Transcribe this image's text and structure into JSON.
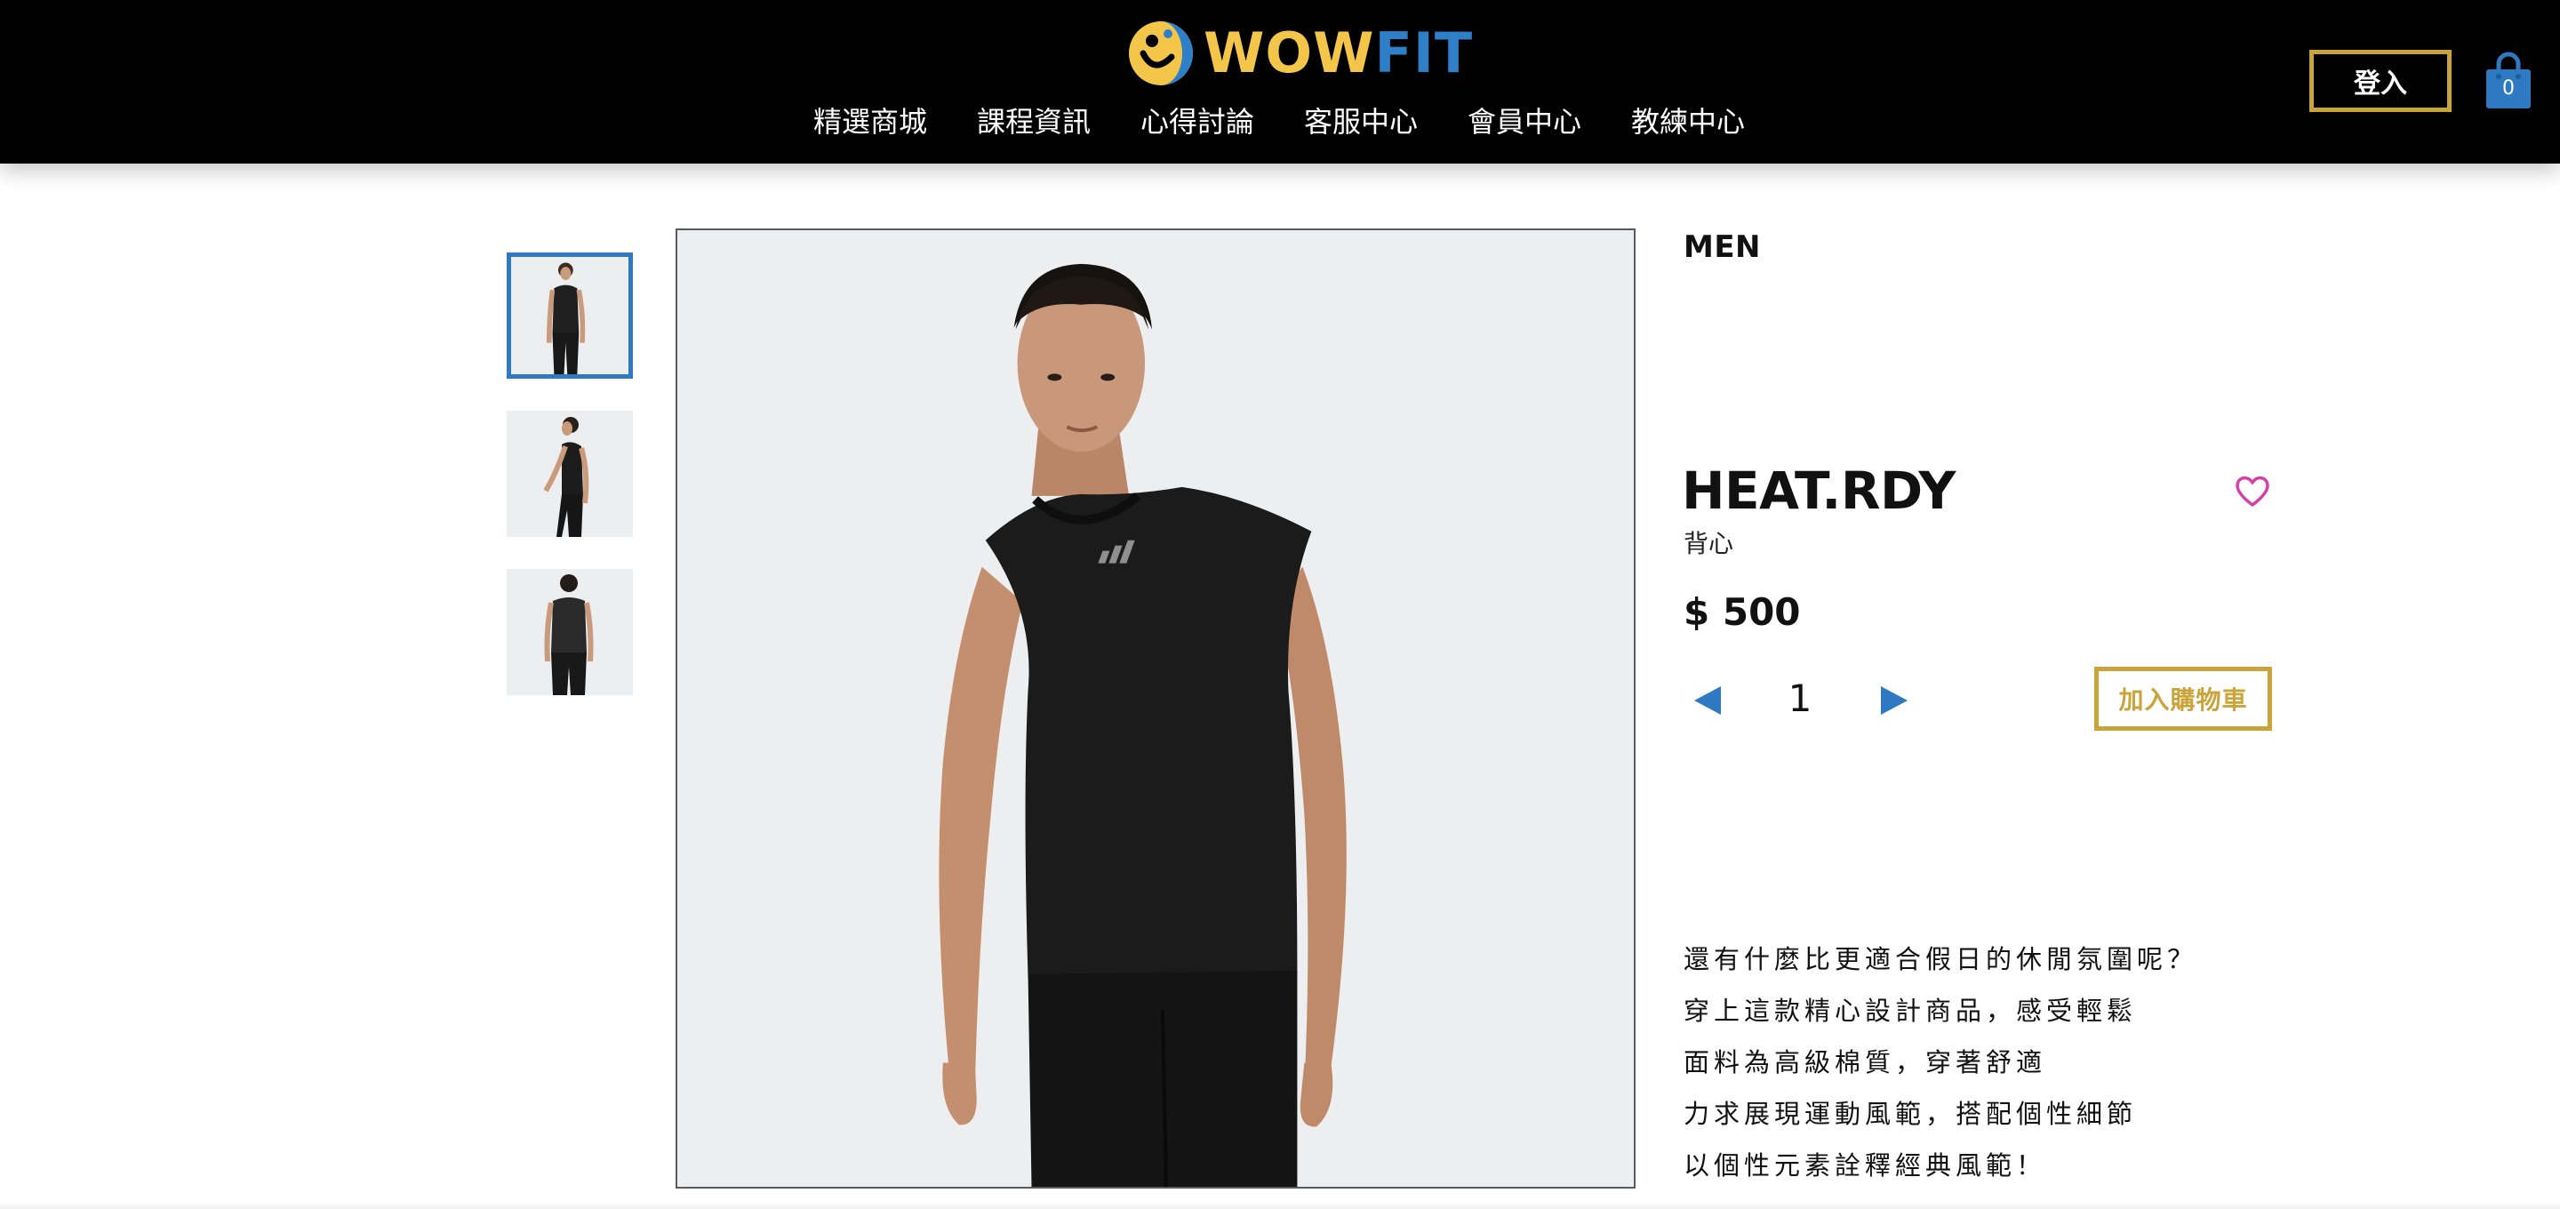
{
  "header": {
    "logo": {
      "word1": "WOW",
      "word2": "FIT",
      "icon": "wowfit-logo-icon"
    },
    "nav": [
      {
        "label": "精選商城"
      },
      {
        "label": "課程資訊"
      },
      {
        "label": "心得討論"
      },
      {
        "label": "客服中心"
      },
      {
        "label": "會員中心"
      },
      {
        "label": "教練中心"
      }
    ],
    "login_label": "登入",
    "cart_count": "0",
    "cart_icon": "shopping-bag-icon"
  },
  "gallery": {
    "selected_index": 0,
    "thumbnails": [
      {
        "view": "front"
      },
      {
        "view": "side"
      },
      {
        "view": "back"
      }
    ]
  },
  "product": {
    "category": "MEN",
    "name": "HEAT.RDY",
    "subtitle": "背心",
    "price": "$ 500",
    "quantity": "1",
    "add_to_cart_label": "加入購物車",
    "favorite_icon": "heart-icon",
    "description": [
      "還有什麼比更適合假日的休閒氛圍呢？",
      "穿上這款精心設計商品，感受輕鬆",
      "面料為高級棉質，穿著舒適",
      "力求展現運動風範，搭配個性細節",
      "以個性元素詮釋經典風範！"
    ]
  },
  "colors": {
    "header_bg": "#000000",
    "accent_gold": "#c9a43b",
    "accent_blue": "#2f79c2",
    "logo_yellow": "#f3c64a",
    "heart_pink": "#d63fa8"
  }
}
